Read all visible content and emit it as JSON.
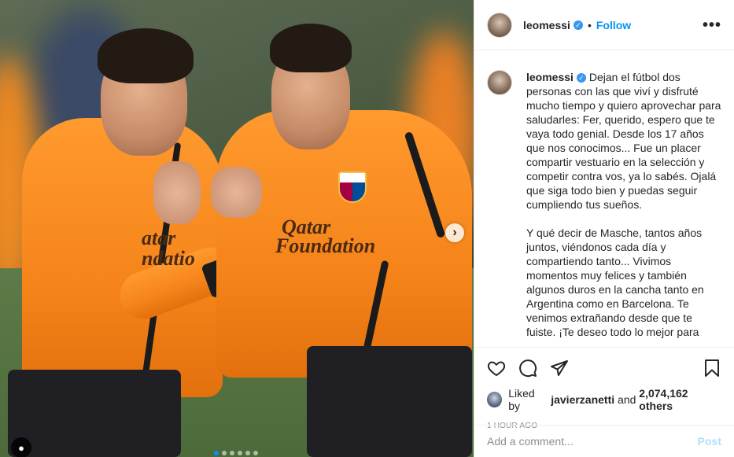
{
  "post": {
    "username": "leomessi",
    "verified": true,
    "separator": "•",
    "follow_label": "Follow",
    "more_label": "•••"
  },
  "photo": {
    "sponsor_line1": "Qatar",
    "sponsor_line2": "Foundation",
    "sponsor_partial": "atar\nndatio",
    "next_icon": "chevron-right-icon",
    "carousel_count": 6,
    "carousel_active": 1
  },
  "caption": {
    "username": "leomessi",
    "paragraph1": "Dejan el fútbol dos personas con las que viví y disfruté mucho tiempo y quiero aprovechar para saludarles: Fer, querido, espero que te vaya todo genial. Desde los 17 años que nos conocimos... Fue un placer compartir vestuario en la selección y competir contra vos, ya lo sabés. Ojalá que siga todo bien y puedas seguir cumpliendo tus sueños.",
    "paragraph2": "Y qué decir de Masche, tantos años juntos, viéndonos cada día y compartiendo tanto... Vivimos momentos muy felices y también algunos duros en la cancha tanto en Argentina como en Barcelona. Te venimos extrañando desde que te fuiste. ¡Te deseo todo lo mejor para"
  },
  "actions": {
    "like_icon": "heart-icon",
    "comment_icon": "comment-icon",
    "share_icon": "share-icon",
    "save_icon": "bookmark-icon"
  },
  "likes": {
    "prefix": "Liked by ",
    "user": "javierzanetti",
    "middle": " and ",
    "count": "2,074,162 others"
  },
  "timestamp": "1 HOUR AGO",
  "comment_box": {
    "placeholder": "Add a comment...",
    "post_label": "Post"
  },
  "colors": {
    "link_blue": "#0095f6",
    "post_disabled": "#b2dffc",
    "verified_blue": "#3897f0",
    "kit_orange": "#f5841a"
  }
}
